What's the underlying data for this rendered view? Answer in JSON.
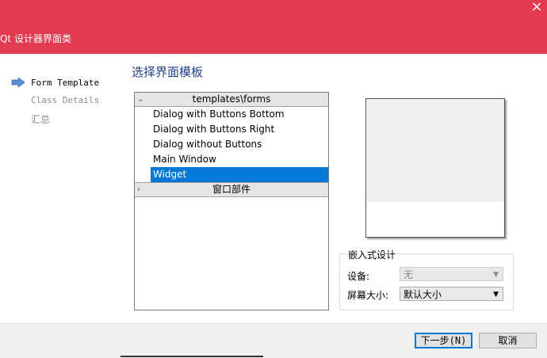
{
  "window": {
    "title": "Qt 设计器界面类",
    "close_glyph": "×"
  },
  "nav": {
    "items": [
      {
        "label": "Form Template",
        "active": true
      },
      {
        "label": "Class Details",
        "active": false
      },
      {
        "label": "汇总",
        "active": false
      }
    ]
  },
  "page": {
    "heading": "选择界面模板"
  },
  "templates": {
    "group1_label": "templates\\forms",
    "group1_items": [
      "Dialog with Buttons Bottom",
      "Dialog with Buttons Right",
      "Dialog without Buttons",
      "Main Window",
      "Widget"
    ],
    "selected": "Widget",
    "group2_label": "窗口部件"
  },
  "embedded": {
    "title": "嵌入式设计",
    "device_label": "设备:",
    "device_value": "无",
    "screen_label": "屏幕大小:",
    "screen_value": "默认大小"
  },
  "buttons": {
    "next": "下一步(N)",
    "cancel": "取消"
  },
  "colors": {
    "titlebar": "#e33a50",
    "selection": "#0078d7",
    "heading": "#1f3f8c"
  }
}
